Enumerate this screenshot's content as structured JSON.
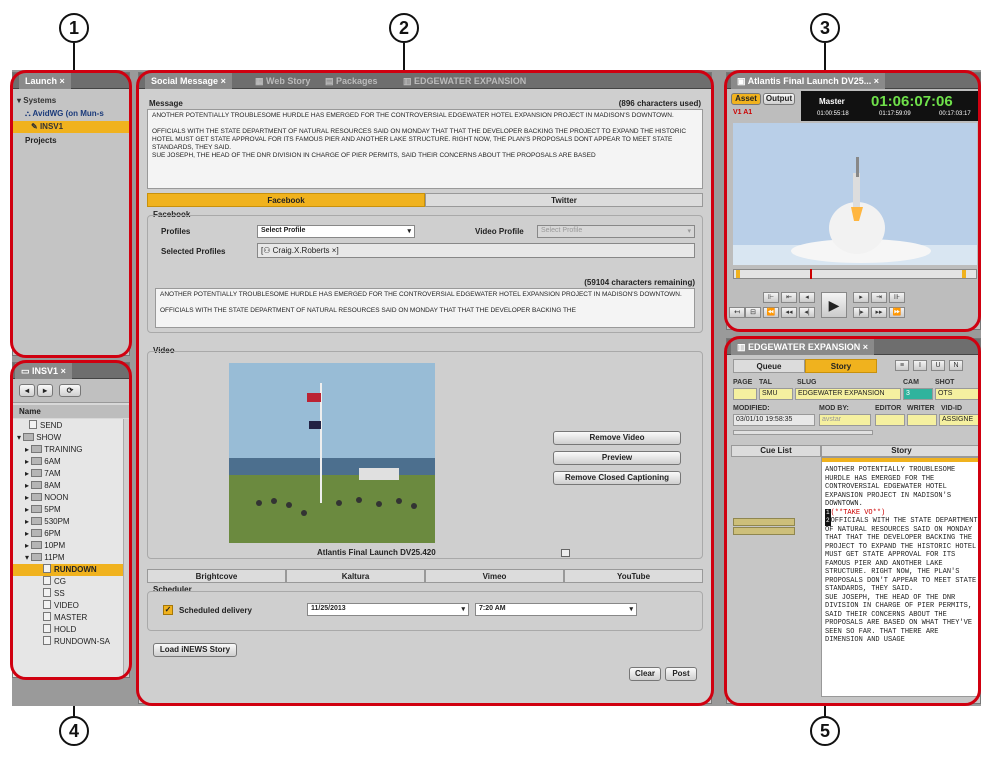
{
  "callouts": [
    "1",
    "2",
    "3",
    "4",
    "5"
  ],
  "launch": {
    "tab": "Launch",
    "systems": "Systems",
    "avid": "AvidWG (on Mun-s",
    "insv1": "INSV1",
    "projects": "Projects"
  },
  "tree": {
    "tab": "INSV1",
    "name_col": "Name",
    "items": [
      "SEND",
      "SHOW",
      "TRAINING",
      "6AM",
      "7AM",
      "8AM",
      "NOON",
      "5PM",
      "530PM",
      "6PM",
      "10PM",
      "11PM",
      "RUNDOWN",
      "CG",
      "SS",
      "VIDEO",
      "MASTER",
      "HOLD",
      "RUNDOWN-SA"
    ]
  },
  "main": {
    "tabs": [
      "Social Message",
      "Web Story",
      "Packages",
      "EDGEWATER EXPANSION"
    ],
    "message_label": "Message",
    "chars_used": "(896 characters used)",
    "message_text": [
      "ANOTHER POTENTIALLY TROUBLESOME HURDLE HAS EMERGED FOR THE CONTROVERSIAL EDGEWATER HOTEL EXPANSION PROJECT IN MADISON'S DOWNTOWN.",
      "",
      "OFFICIALS WITH THE STATE DEPARTMENT OF NATURAL RESOURCES SAID ON MONDAY THAT THAT THE DEVELOPER BACKING THE PROJECT TO EXPAND THE HISTORIC HOTEL MUST GET STATE APPROVAL FOR ITS FAMOUS PIER AND ANOTHER LAKE STRUCTURE. RIGHT NOW, THE PLAN'S PROPOSALS DONT APPEAR TO MEET STATE STANDARDS, THEY SAID.",
      "SUE JOSEPH, THE HEAD OF THE DNR DIVISION IN CHARGE OF PIER PERMITS, SAID THEIR CONCERNS ABOUT THE PROPOSALS ARE BASED"
    ],
    "share_tabs": [
      "Facebook",
      "Twitter"
    ],
    "facebook_label": "Facebook",
    "profiles_label": "Profiles",
    "profiles_value": "Select Profile",
    "video_profile_label": "Video Profile",
    "video_profile_value": "Select Profile",
    "selected_profiles_label": "Selected Profiles",
    "selected_profile": "Craig.X.Roberts",
    "chars_remaining": "(59104 characters remaining)",
    "fb_text": [
      "ANOTHER POTENTIALLY TROUBLESOME HURDLE HAS EMERGED FOR THE CONTROVERSIAL EDGEWATER HOTEL EXPANSION PROJECT IN MADISON'S DOWNTOWN.",
      "",
      "OFFICIALS WITH THE STATE DEPARTMENT OF NATURAL RESOURCES SAID ON MONDAY THAT THAT THE DEVELOPER BACKING THE"
    ],
    "video_label": "Video",
    "video_caption": "Atlantis Final Launch DV25.420",
    "remove_video": "Remove Video",
    "preview": "Preview",
    "remove_cc": "Remove Closed Captioning",
    "platforms": [
      "Brightcove",
      "Kaltura",
      "Vimeo",
      "YouTube"
    ],
    "scheduler_label": "Scheduler",
    "scheduled_delivery": "Scheduled delivery",
    "date": "11/25/2013",
    "time": "7:20 AM",
    "load_inews": "Load iNEWS Story",
    "clear": "Clear",
    "post": "Post"
  },
  "player": {
    "tab": "Atlantis Final Launch DV25...",
    "asset": "Asset",
    "output": "Output",
    "master": "Master",
    "timecode": "01:06:07:06",
    "track": "V1 A1",
    "tc_small": [
      "01:00:55:18",
      "01:17:59:09",
      "00:17:03:17"
    ]
  },
  "story": {
    "tab": "EDGEWATER EXPANSION",
    "queue": "Queue",
    "story": "Story",
    "page_lbl": "PAGE",
    "tal_lbl": "TAL",
    "slug_lbl": "SLUG",
    "cam_lbl": "CAM",
    "shot_lbl": "SHOT",
    "tal_val": "SMU",
    "slug_val": "EDGEWATER EXPANSION",
    "cam_val": "3",
    "shot_val": "OTS",
    "modified_lbl": "MODIFIED:",
    "modby_lbl": "MOD BY:",
    "editor_lbl": "EDITOR",
    "writer_lbl": "WRITER",
    "vidid_lbl": "VID-ID",
    "modified_val": "03/01/10 19:58:35",
    "modby_val": "avstar",
    "vidid_val": "ASSIGNE",
    "cue_list": "Cue List",
    "story_col": "Story",
    "take_vo": "(**TAKE VO**)",
    "text1": "ANOTHER POTENTIALLY TROUBLESOME HURDLE HAS EMERGED FOR THE CONTROVERSIAL EDGEWATER HOTEL EXPANSION PROJECT IN MADISON'S DOWNTOWN.",
    "text2": "OFFICIALS WITH THE STATE DEPARTMENT OF NATURAL RESOURCES SAID ON MONDAY THAT THAT THE DEVELOPER BACKING THE PROJECT TO EXPAND THE HISTORIC HOTEL MUST GET STATE APPROVAL FOR ITS FAMOUS PIER AND ANOTHER LAKE STRUCTURE. RIGHT NOW, THE PLAN'S PROPOSALS DON'T APPEAR TO MEET STATE STANDARDS, THEY SAID.",
    "text3": "SUE JOSEPH, THE HEAD OF THE DNR DIVISION IN CHARGE OF PIER PERMITS, SAID THEIR CONCERNS ABOUT THE PROPOSALS ARE BASED ON WHAT THEY'VE SEEN SO FAR. THAT THERE ARE DIMENSION AND USAGE"
  }
}
